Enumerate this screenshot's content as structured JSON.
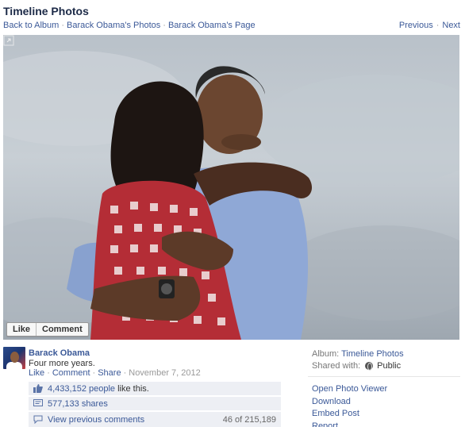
{
  "page": {
    "title": "Timeline Photos"
  },
  "breadcrumb": {
    "back": "Back to Album",
    "photos": "Barack Obama's Photos",
    "page": "Barack Obama's Page",
    "separator": "·"
  },
  "pager": {
    "previous": "Previous",
    "separator": "·",
    "next": "Next"
  },
  "photo": {
    "overlay": {
      "like": "Like",
      "comment": "Comment"
    },
    "expand_icon": "expand-icon"
  },
  "post": {
    "author": "Barack Obama",
    "caption": "Four more years.",
    "actions": {
      "like": "Like",
      "comment": "Comment",
      "share": "Share"
    },
    "date": "November 7, 2012",
    "separator": "·"
  },
  "ufi": {
    "likes_count": "4,433,152 people",
    "likes_suffix": "like this.",
    "shares": "577,133 shares",
    "view_previous": "View previous comments",
    "comment_count": "46 of 215,189"
  },
  "sidebar": {
    "album_label": "Album:",
    "album_value": "Timeline Photos",
    "shared_label": "Shared with:",
    "shared_value": "Public",
    "actions": [
      "Open Photo Viewer",
      "Download",
      "Embed Post",
      "Report"
    ]
  },
  "colors": {
    "link": "#3b5998",
    "ufi_bg": "#edeff4",
    "title": "#1c2a47"
  }
}
